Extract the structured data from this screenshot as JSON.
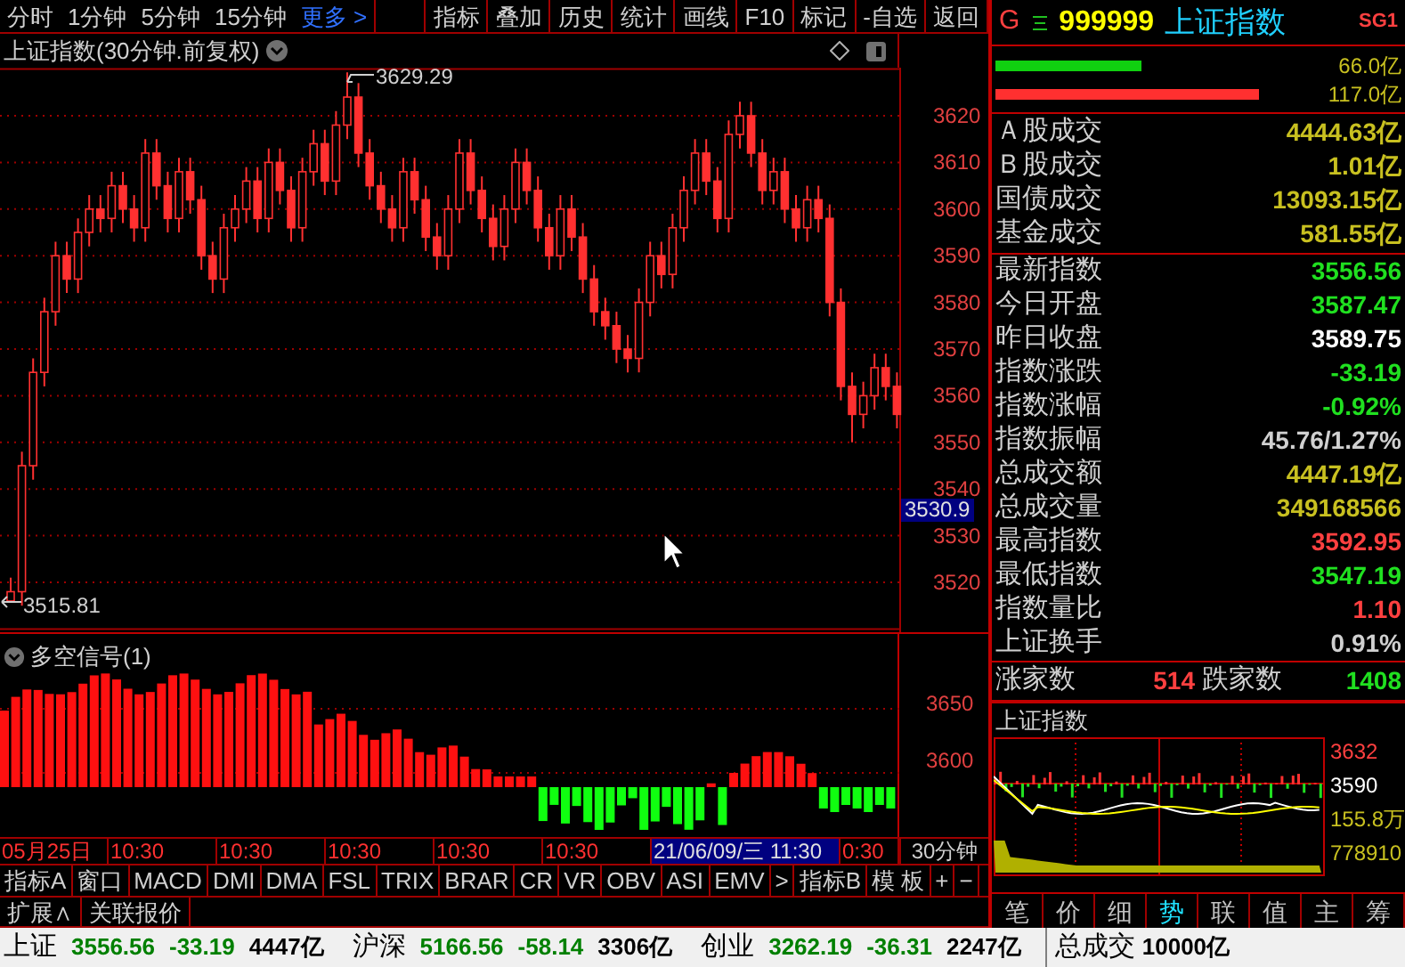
{
  "toolbar": {
    "periods": [
      "分时",
      "1分钟",
      "5分钟",
      "15分钟"
    ],
    "more": "更多 >",
    "tools": [
      "指标",
      "叠加",
      "历史",
      "统计",
      "画线",
      "F10",
      "标记",
      "-自选",
      "返回"
    ]
  },
  "chart": {
    "title": "上证指数(30分钟.前复权)",
    "current_price": "3530.9",
    "high_marker": "3629.29",
    "low_marker": "3515.81",
    "chart_data": {
      "type": "candlestick",
      "grid": true,
      "ylim": [
        3510,
        3630
      ],
      "yticks": [
        3620,
        3610,
        3600,
        3590,
        3580,
        3570,
        3560,
        3550,
        3540,
        3530,
        3520
      ],
      "ohlc": [
        [
          3516,
          3521,
          3515.81,
          3518
        ],
        [
          3518,
          3548,
          3515,
          3545
        ],
        [
          3545,
          3568,
          3542,
          3565
        ],
        [
          3565,
          3581,
          3562,
          3578
        ],
        [
          3578,
          3593,
          3575,
          3590
        ],
        [
          3590,
          3593,
          3582,
          3585
        ],
        [
          3585,
          3598,
          3582,
          3595
        ],
        [
          3595,
          3603,
          3592,
          3600
        ],
        [
          3600,
          3603,
          3595,
          3598
        ],
        [
          3598,
          3608,
          3595,
          3605
        ],
        [
          3605,
          3608,
          3597,
          3600
        ],
        [
          3600,
          3603,
          3593,
          3596
        ],
        [
          3596,
          3615,
          3593,
          3612
        ],
        [
          3612,
          3615,
          3602,
          3605
        ],
        [
          3605,
          3608,
          3595,
          3598
        ],
        [
          3598,
          3611,
          3595,
          3608
        ],
        [
          3608,
          3611,
          3599,
          3602
        ],
        [
          3602,
          3605,
          3587,
          3590
        ],
        [
          3590,
          3593,
          3582,
          3585
        ],
        [
          3585,
          3599,
          3582,
          3596
        ],
        [
          3596,
          3603,
          3593,
          3600
        ],
        [
          3600,
          3609,
          3597,
          3606
        ],
        [
          3606,
          3609,
          3595,
          3598
        ],
        [
          3598,
          3613,
          3595,
          3610
        ],
        [
          3610,
          3613,
          3601,
          3604
        ],
        [
          3604,
          3607,
          3593,
          3596
        ],
        [
          3596,
          3611,
          3593,
          3608
        ],
        [
          3608,
          3617,
          3605,
          3614
        ],
        [
          3614,
          3617,
          3603,
          3606
        ],
        [
          3606,
          3621,
          3603,
          3618
        ],
        [
          3618,
          3629.29,
          3615,
          3624
        ],
        [
          3624,
          3627,
          3609,
          3612
        ],
        [
          3612,
          3615,
          3602,
          3605
        ],
        [
          3605,
          3608,
          3597,
          3600
        ],
        [
          3600,
          3603,
          3593,
          3596
        ],
        [
          3596,
          3611,
          3593,
          3608
        ],
        [
          3608,
          3611,
          3599,
          3602
        ],
        [
          3602,
          3605,
          3591,
          3594
        ],
        [
          3594,
          3597,
          3587,
          3590
        ],
        [
          3590,
          3603,
          3587,
          3600
        ],
        [
          3600,
          3615,
          3597,
          3612
        ],
        [
          3612,
          3615,
          3601,
          3604
        ],
        [
          3604,
          3607,
          3595,
          3598
        ],
        [
          3598,
          3601,
          3589,
          3592
        ],
        [
          3592,
          3603,
          3589,
          3600
        ],
        [
          3600,
          3613,
          3597,
          3610
        ],
        [
          3610,
          3613,
          3601,
          3604
        ],
        [
          3604,
          3607,
          3593,
          3596
        ],
        [
          3596,
          3599,
          3587,
          3590
        ],
        [
          3590,
          3603,
          3587,
          3600
        ],
        [
          3600,
          3603,
          3591,
          3594
        ],
        [
          3594,
          3597,
          3582,
          3585
        ],
        [
          3585,
          3588,
          3575,
          3578
        ],
        [
          3578,
          3581,
          3572,
          3575
        ],
        [
          3575,
          3578,
          3567,
          3570
        ],
        [
          3570,
          3573,
          3565,
          3568
        ],
        [
          3568,
          3583,
          3565,
          3580
        ],
        [
          3580,
          3593,
          3577,
          3590
        ],
        [
          3590,
          3593,
          3583,
          3586
        ],
        [
          3586,
          3599,
          3583,
          3596
        ],
        [
          3596,
          3607,
          3593,
          3604
        ],
        [
          3604,
          3615,
          3601,
          3612
        ],
        [
          3612,
          3615,
          3603,
          3606
        ],
        [
          3606,
          3609,
          3595,
          3598
        ],
        [
          3598,
          3619,
          3595,
          3616
        ],
        [
          3616,
          3623,
          3613,
          3620
        ],
        [
          3620,
          3623,
          3609,
          3612
        ],
        [
          3612,
          3615,
          3601,
          3604
        ],
        [
          3604,
          3611,
          3601,
          3608
        ],
        [
          3608,
          3611,
          3597,
          3600
        ],
        [
          3600,
          3603,
          3593,
          3596
        ],
        [
          3596,
          3605,
          3593,
          3602
        ],
        [
          3602,
          3605,
          3595,
          3598
        ],
        [
          3598,
          3601,
          3577,
          3580
        ],
        [
          3580,
          3583,
          3559,
          3562
        ],
        [
          3562,
          3565,
          3550,
          3556
        ],
        [
          3556,
          3563,
          3553,
          3560
        ],
        [
          3560,
          3569,
          3557,
          3566
        ],
        [
          3566,
          3569,
          3559,
          3562
        ],
        [
          3562,
          3565,
          3553,
          3556
        ]
      ]
    }
  },
  "indicator": {
    "title": "多空信号(1)",
    "y_labels": [
      "3650",
      "3600"
    ]
  },
  "time_axis": {
    "items": [
      {
        "kind": "date",
        "text": "05月25日"
      },
      {
        "kind": "time",
        "text": "10:30"
      },
      {
        "kind": "time",
        "text": "10:30"
      },
      {
        "kind": "time",
        "text": "10:30"
      },
      {
        "kind": "time",
        "text": "10:30"
      },
      {
        "kind": "time",
        "text": "10:30"
      },
      {
        "kind": "cursor",
        "text": "21/06/09/三 11:30"
      },
      {
        "kind": "time",
        "text": "0:30"
      }
    ],
    "period": "30分钟"
  },
  "indicator_tabs": [
    "指标A",
    "窗口",
    "MACD",
    "DMI",
    "DMA",
    "FSL",
    "TRIX",
    "BRAR",
    "CR",
    "VR",
    "OBV",
    "ASI",
    "EMV",
    ">",
    "指标B",
    "模 板",
    "+",
    "−"
  ],
  "extension_tabs": [
    "扩展∧",
    "关联报价"
  ],
  "quote": {
    "market": "G",
    "code": "999999",
    "name": "上证指数",
    "badge": "SG1"
  },
  "flow": [
    {
      "kind": "buy",
      "amount": "66.0亿",
      "level": 0.36
    },
    {
      "kind": "sell",
      "amount": "117.0亿",
      "level": 0.65
    }
  ],
  "turnover": [
    {
      "label": "Ａ股成交",
      "value": "4444.63亿",
      "color": "#c8c020"
    },
    {
      "label": "Ｂ股成交",
      "value": "1.01亿",
      "color": "#c8c020"
    },
    {
      "label": "国债成交",
      "value": "13093.15亿",
      "color": "#c8c020"
    },
    {
      "label": "基金成交",
      "value": "581.55亿",
      "color": "#c8c020"
    }
  ],
  "stats": [
    {
      "label": "最新指数",
      "value": "3556.56",
      "color": "#20e020"
    },
    {
      "label": "今日开盘",
      "value": "3587.47",
      "color": "#20e020"
    },
    {
      "label": "昨日收盘",
      "value": "3589.75",
      "color": "#ffffff"
    },
    {
      "label": "指数涨跌",
      "value": "-33.19",
      "color": "#20e020"
    },
    {
      "label": "指数涨幅",
      "value": "-0.92%",
      "color": "#20e020"
    },
    {
      "label": "指数振幅",
      "value": "45.76/1.27%",
      "color": "#d0d0d0"
    },
    {
      "label": "总成交额",
      "value": "4447.19亿",
      "color": "#c8c020"
    },
    {
      "label": "总成交量",
      "value": "349168566",
      "color": "#c8c020"
    },
    {
      "label": "最高指数",
      "value": "3592.95",
      "color": "#ff4040"
    },
    {
      "label": "最低指数",
      "value": "3547.19",
      "color": "#20e020"
    },
    {
      "label": "指数量比",
      "value": "1.10",
      "color": "#ff4040"
    },
    {
      "label": "上证换手",
      "value": "0.91%",
      "color": "#d0d0d0"
    }
  ],
  "breadth": {
    "up_label": "涨家数",
    "up": "514",
    "down_label": "跌家数",
    "down": "1408"
  },
  "mini_chart": {
    "title": "上证指数",
    "labels": [
      {
        "text": "3632",
        "color": "#ff4040"
      },
      {
        "text": "3590",
        "color": "#ffffff"
      },
      {
        "text": "155.8万",
        "color": "#c8c020"
      },
      {
        "text": "778910",
        "color": "#c8c020"
      }
    ]
  },
  "detail_tabs": [
    {
      "label": "笔",
      "selected": false
    },
    {
      "label": "价",
      "selected": false
    },
    {
      "label": "细",
      "selected": false
    },
    {
      "label": "势",
      "selected": true
    },
    {
      "label": "联",
      "selected": false
    },
    {
      "label": "值",
      "selected": false
    },
    {
      "label": "主",
      "selected": false
    },
    {
      "label": "筹",
      "selected": false
    }
  ],
  "status_bar": {
    "indices": [
      {
        "name": "上证",
        "price": "3556.56",
        "change": "-33.19",
        "amount": "4447亿"
      },
      {
        "name": "沪深",
        "price": "5166.56",
        "change": "-58.14",
        "amount": "3306亿"
      },
      {
        "name": "创业",
        "price": "3262.19",
        "change": "-36.31",
        "amount": "2247亿"
      }
    ],
    "total_label": "总成交",
    "total": "10000亿"
  }
}
